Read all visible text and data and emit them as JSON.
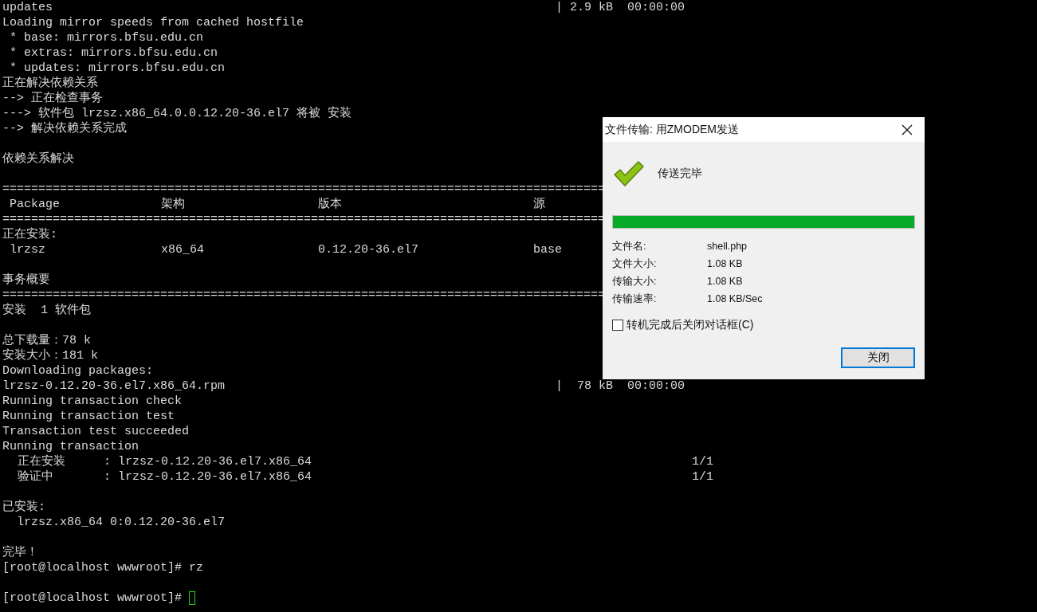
{
  "terminal": {
    "lines": [
      {
        "kind": "split",
        "text": "updates",
        "right": "| 2.9 kB  00:00:00"
      },
      {
        "kind": "text",
        "text": "Loading mirror speeds from cached hostfile"
      },
      {
        "kind": "text",
        "text": " * base: mirrors.bfsu.edu.cn"
      },
      {
        "kind": "text",
        "text": " * extras: mirrors.bfsu.edu.cn"
      },
      {
        "kind": "text",
        "text": " * updates: mirrors.bfsu.edu.cn"
      },
      {
        "kind": "text",
        "text": "正在解决依赖关系"
      },
      {
        "kind": "text",
        "text": "--> 正在检查事务"
      },
      {
        "kind": "text",
        "text": "---> 软件包 lrzsz.x86_64.0.0.12.20-36.el7 将被 安装"
      },
      {
        "kind": "text",
        "text": "--> 解决依赖关系完成"
      },
      {
        "kind": "blank"
      },
      {
        "kind": "text",
        "text": "依赖关系解决"
      },
      {
        "kind": "blank"
      },
      {
        "kind": "rule",
        "text": "===================================================================================="
      },
      {
        "kind": "table",
        "cells": [
          "Package",
          "架构",
          "版本",
          "源"
        ]
      },
      {
        "kind": "rule",
        "text": "===================================================================================="
      },
      {
        "kind": "text",
        "text": "正在安装:"
      },
      {
        "kind": "table",
        "cells": [
          "lrzsz",
          "x86_64",
          "0.12.20-36.el7",
          "base"
        ]
      },
      {
        "kind": "blank"
      },
      {
        "kind": "text",
        "text": "事务概要"
      },
      {
        "kind": "rule",
        "text": "===================================================================================="
      },
      {
        "kind": "text",
        "text": "安装  1 软件包"
      },
      {
        "kind": "blank"
      },
      {
        "kind": "text",
        "text": "总下载量：78 k"
      },
      {
        "kind": "text",
        "text": "安装大小：181 k"
      },
      {
        "kind": "text",
        "text": "Downloading packages:"
      },
      {
        "kind": "split",
        "text": "lrzsz-0.12.20-36.el7.x86_64.rpm",
        "right": "|  78 kB  00:00:00"
      },
      {
        "kind": "text",
        "text": "Running transaction check"
      },
      {
        "kind": "text",
        "text": "Running transaction test"
      },
      {
        "kind": "text",
        "text": "Transaction test succeeded"
      },
      {
        "kind": "text",
        "text": "Running transaction"
      },
      {
        "kind": "step",
        "label": "正在安装",
        "detail": ": lrzsz-0.12.20-36.el7.x86_64",
        "count": "1/1"
      },
      {
        "kind": "step",
        "label": "验证中",
        "detail": ": lrzsz-0.12.20-36.el7.x86_64",
        "count": "1/1"
      },
      {
        "kind": "blank"
      },
      {
        "kind": "text",
        "text": "已安装:"
      },
      {
        "kind": "text",
        "text": "  lrzsz.x86_64 0:0.12.20-36.el7"
      },
      {
        "kind": "blank"
      },
      {
        "kind": "text",
        "text": "完毕！"
      },
      {
        "kind": "text",
        "text": "[root@localhost wwwroot]# rz"
      },
      {
        "kind": "blank"
      },
      {
        "kind": "prompt",
        "text": "[root@localhost wwwroot]# "
      }
    ]
  },
  "dialog": {
    "title": "文件传输: 用ZMODEM发送",
    "status": "传送完毕",
    "level": 1,
    "info": [
      {
        "label": "文件名:",
        "value": "shell.php"
      },
      {
        "label": "文件大小:",
        "value": "1.08 KB"
      },
      {
        "label": "传输大小:",
        "value": "1.08 KB"
      },
      {
        "label": "传输速率:",
        "value": "1.08 KB/Sec"
      }
    ],
    "checkbox": {
      "label": "转机完成后关闭对话框(C)",
      "checked": false
    },
    "button": "关闭"
  }
}
